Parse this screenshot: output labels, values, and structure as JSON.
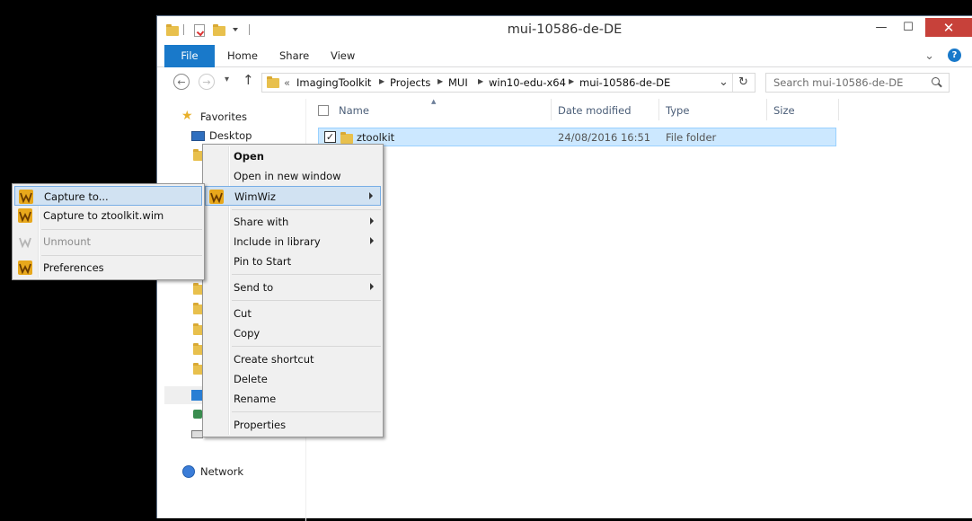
{
  "window": {
    "title": "mui-10586-de-DE",
    "minimize_glyph": "—",
    "maximize_glyph": "☐",
    "close_glyph": "✕"
  },
  "ribbon": {
    "tabs": [
      "File",
      "Home",
      "Share",
      "View"
    ],
    "help_glyph": "?",
    "collapse_glyph": "⌄"
  },
  "nav": {
    "back_glyph": "←",
    "forward_glyph": "→",
    "recent_glyph": "▾",
    "up_glyph": "↑"
  },
  "address": {
    "overflow": "«",
    "crumbs": [
      "ImagingToolkit",
      "Projects",
      "MUI",
      "win10-edu-x64",
      "mui-10586-de-DE"
    ],
    "dropdown_glyph": "⌄",
    "refresh_glyph": "↻"
  },
  "search": {
    "placeholder": "Search mui-10586-de-DE",
    "icon": "search-icon"
  },
  "navpane": {
    "favorites": "Favorites",
    "desktop": "Desktop",
    "network": "Network"
  },
  "columns": [
    "Name",
    "Date modified",
    "Type",
    "Size"
  ],
  "files": [
    {
      "name": "ztoolkit",
      "date": "24/08/2016 16:51",
      "type": "File folder",
      "size": ""
    }
  ],
  "context_menu": {
    "items": [
      {
        "label": "Open",
        "bold": true
      },
      {
        "label": "Open in new window"
      },
      {
        "label": "WimWiz",
        "submenu": true,
        "highlighted": true
      },
      {
        "label": "Share with",
        "submenu": true
      },
      {
        "label": "Include in library",
        "submenu": true
      },
      {
        "label": "Pin to Start"
      },
      {
        "label": "Send to",
        "submenu": true
      },
      {
        "label": "Cut"
      },
      {
        "label": "Copy"
      },
      {
        "label": "Create shortcut"
      },
      {
        "label": "Delete"
      },
      {
        "label": "Rename"
      },
      {
        "label": "Properties"
      }
    ]
  },
  "submenu": {
    "items": [
      {
        "label": "Capture to...",
        "highlighted": true
      },
      {
        "label": "Capture to ztoolkit.wim"
      },
      {
        "label": "Unmount",
        "disabled": true
      },
      {
        "label": "Preferences"
      }
    ]
  },
  "colors": {
    "accent": "#1979ca",
    "selection": "#cce8ff",
    "close": "#c7413a",
    "wimwiz_icon": "#e8a81c"
  }
}
